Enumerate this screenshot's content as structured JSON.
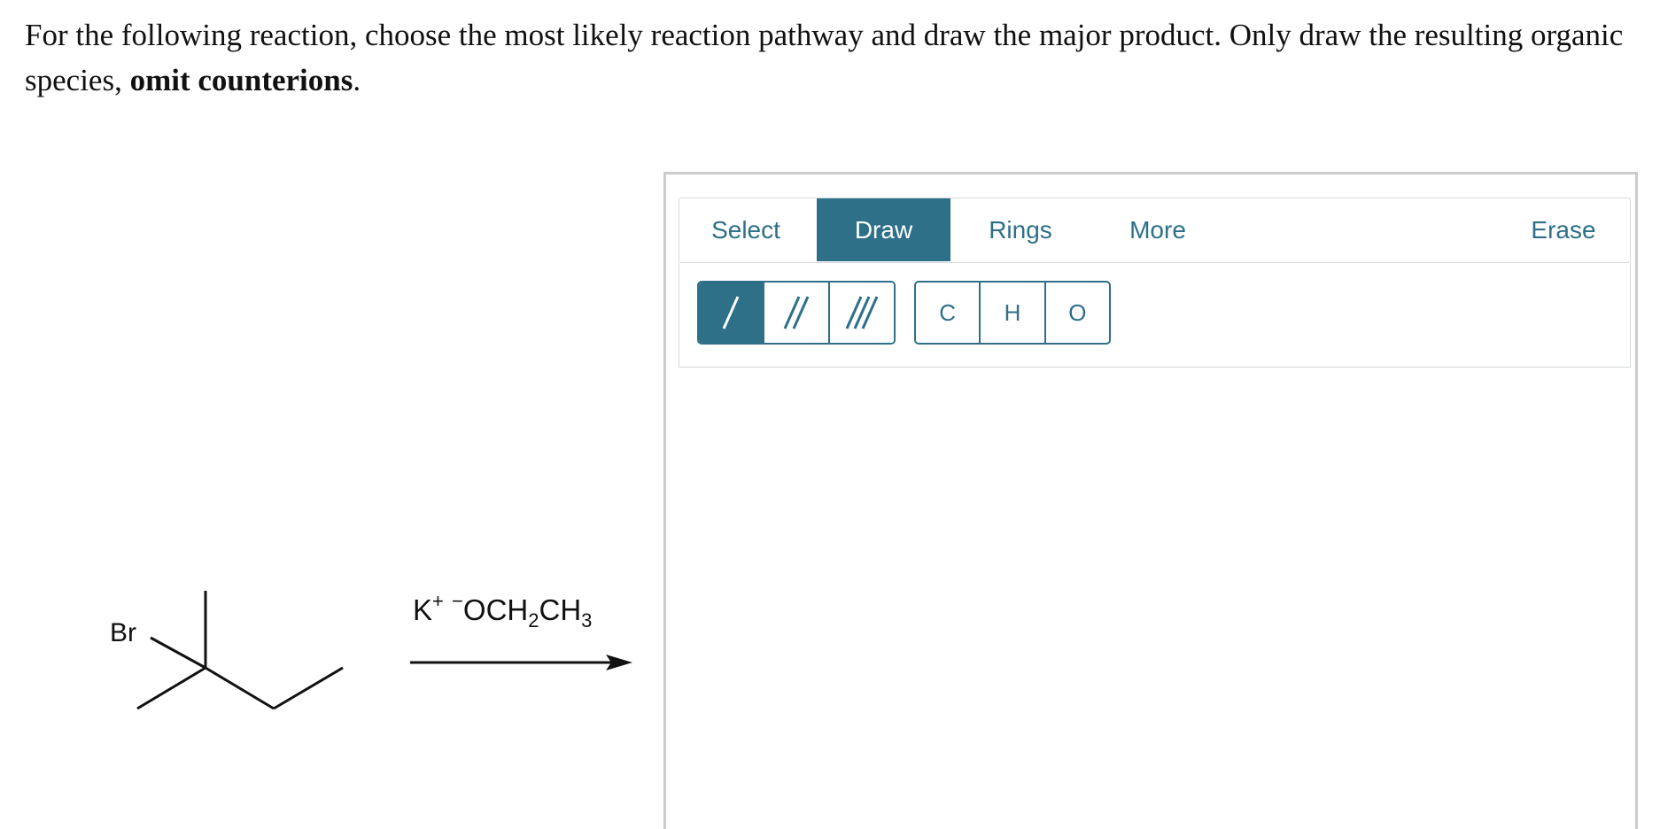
{
  "question": {
    "text": "For the following reaction, choose the most likely reaction pathway and draw the major product. Only draw the resulting organic species, ",
    "bold": "omit counterions",
    "end": "."
  },
  "reaction": {
    "leaving_group": "Br",
    "reagent": {
      "cation": "K",
      "cation_charge": "+",
      "anion_charge": "−",
      "p1": "OCH",
      "s1": "2",
      "p2": "CH",
      "s2": "3"
    }
  },
  "editor": {
    "tabs": [
      {
        "label": "Select",
        "active": false
      },
      {
        "label": "Draw",
        "active": true
      },
      {
        "label": "Rings",
        "active": false
      },
      {
        "label": "More",
        "active": false
      },
      {
        "label": "Erase",
        "active": false
      }
    ],
    "bond_tools": [
      {
        "icon": "single-bond-icon",
        "active": true
      },
      {
        "icon": "double-bond-icon",
        "active": false
      },
      {
        "icon": "triple-bond-icon",
        "active": false
      }
    ],
    "atoms": [
      "C",
      "H",
      "O"
    ],
    "colors": {
      "accent": "#2d7088",
      "border": "#cccccc"
    }
  }
}
